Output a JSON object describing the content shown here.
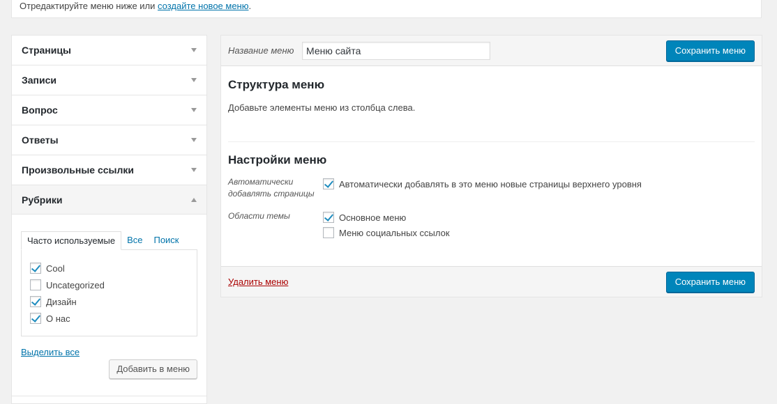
{
  "notice": {
    "text": "Отредактируйте меню ниже или ",
    "link": "создайте новое меню",
    "suffix": "."
  },
  "accordion": {
    "sections": [
      {
        "label": "Страницы"
      },
      {
        "label": "Записи"
      },
      {
        "label": "Вопрос"
      },
      {
        "label": "Ответы"
      },
      {
        "label": "Произвольные ссылки"
      },
      {
        "label": "Рубрики"
      }
    ],
    "tabs": [
      "Часто используемые",
      "Все",
      "Поиск"
    ],
    "items": [
      {
        "label": "Cool",
        "checked": true
      },
      {
        "label": "Uncategorized",
        "checked": false
      },
      {
        "label": "Дизайн",
        "checked": true
      },
      {
        "label": "О нас",
        "checked": true
      }
    ],
    "select_all": "Выделить все",
    "add_button": "Добавить в меню"
  },
  "menu": {
    "name_label": "Название меню",
    "name_value": "Меню сайта",
    "save_label": "Сохранить меню",
    "structure_title": "Структура меню",
    "structure_desc": "Добавьте элементы меню из столбца слева.",
    "settings_title": "Настройки меню",
    "auto_add_label_1": "Автоматически",
    "auto_add_label_2": "добавлять страницы",
    "auto_add_option": "Автоматически добавлять в это меню новые страницы верхнего уровня",
    "theme_areas_label": "Области темы",
    "theme_opt_1": "Основное меню",
    "theme_opt_2": "Меню социальных ссылок",
    "delete_label": "Удалить меню"
  },
  "colors": {
    "accent": "#0085ba",
    "link": "#0073aa",
    "danger": "#aa0000"
  }
}
